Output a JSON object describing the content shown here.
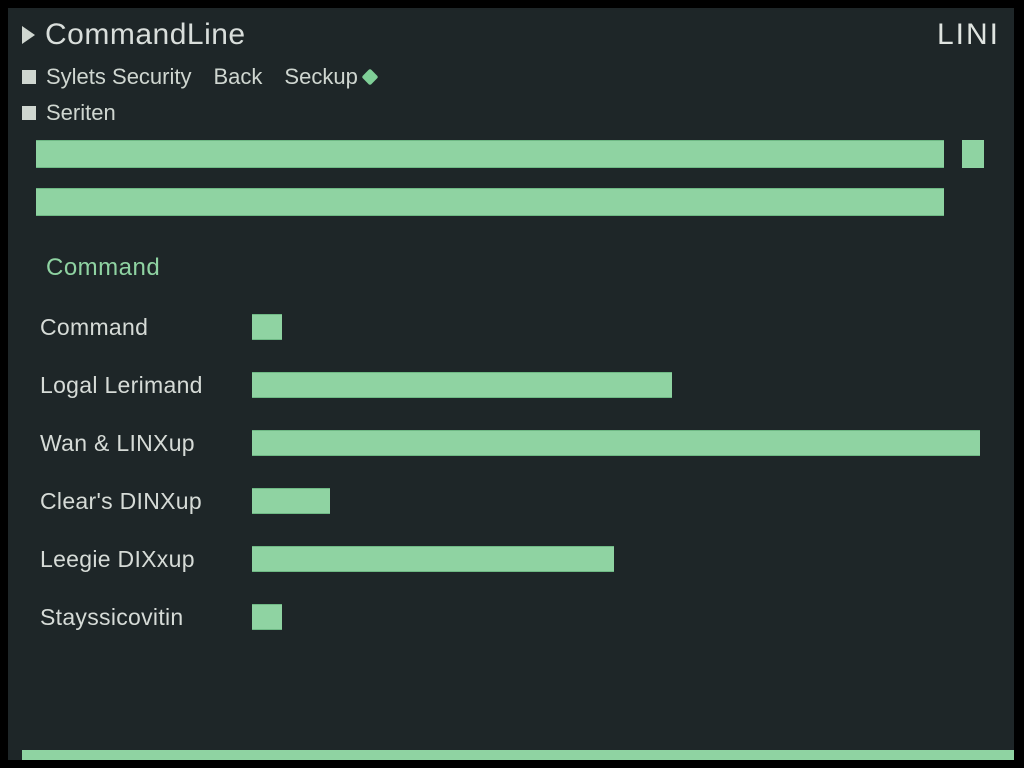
{
  "header": {
    "title": "CommandLine",
    "right_label": "LINI"
  },
  "tabs": [
    {
      "label": "Sylets Security"
    },
    {
      "label": "Back"
    },
    {
      "label": "Seckup"
    }
  ],
  "subitem": {
    "label": "Seriten"
  },
  "section_label": "Command",
  "chart_data": {
    "type": "bar",
    "orientation": "horizontal",
    "xlim": [
      0,
      100
    ],
    "categories": [
      "Command",
      "Logal Lerimand",
      "Wan & LINXup",
      "Clear's DINXup",
      "Leegie DIXxup",
      "Stayssicovitin"
    ],
    "values": [
      4,
      54,
      94,
      10,
      47,
      4
    ]
  },
  "top_bars": [
    100,
    100
  ]
}
